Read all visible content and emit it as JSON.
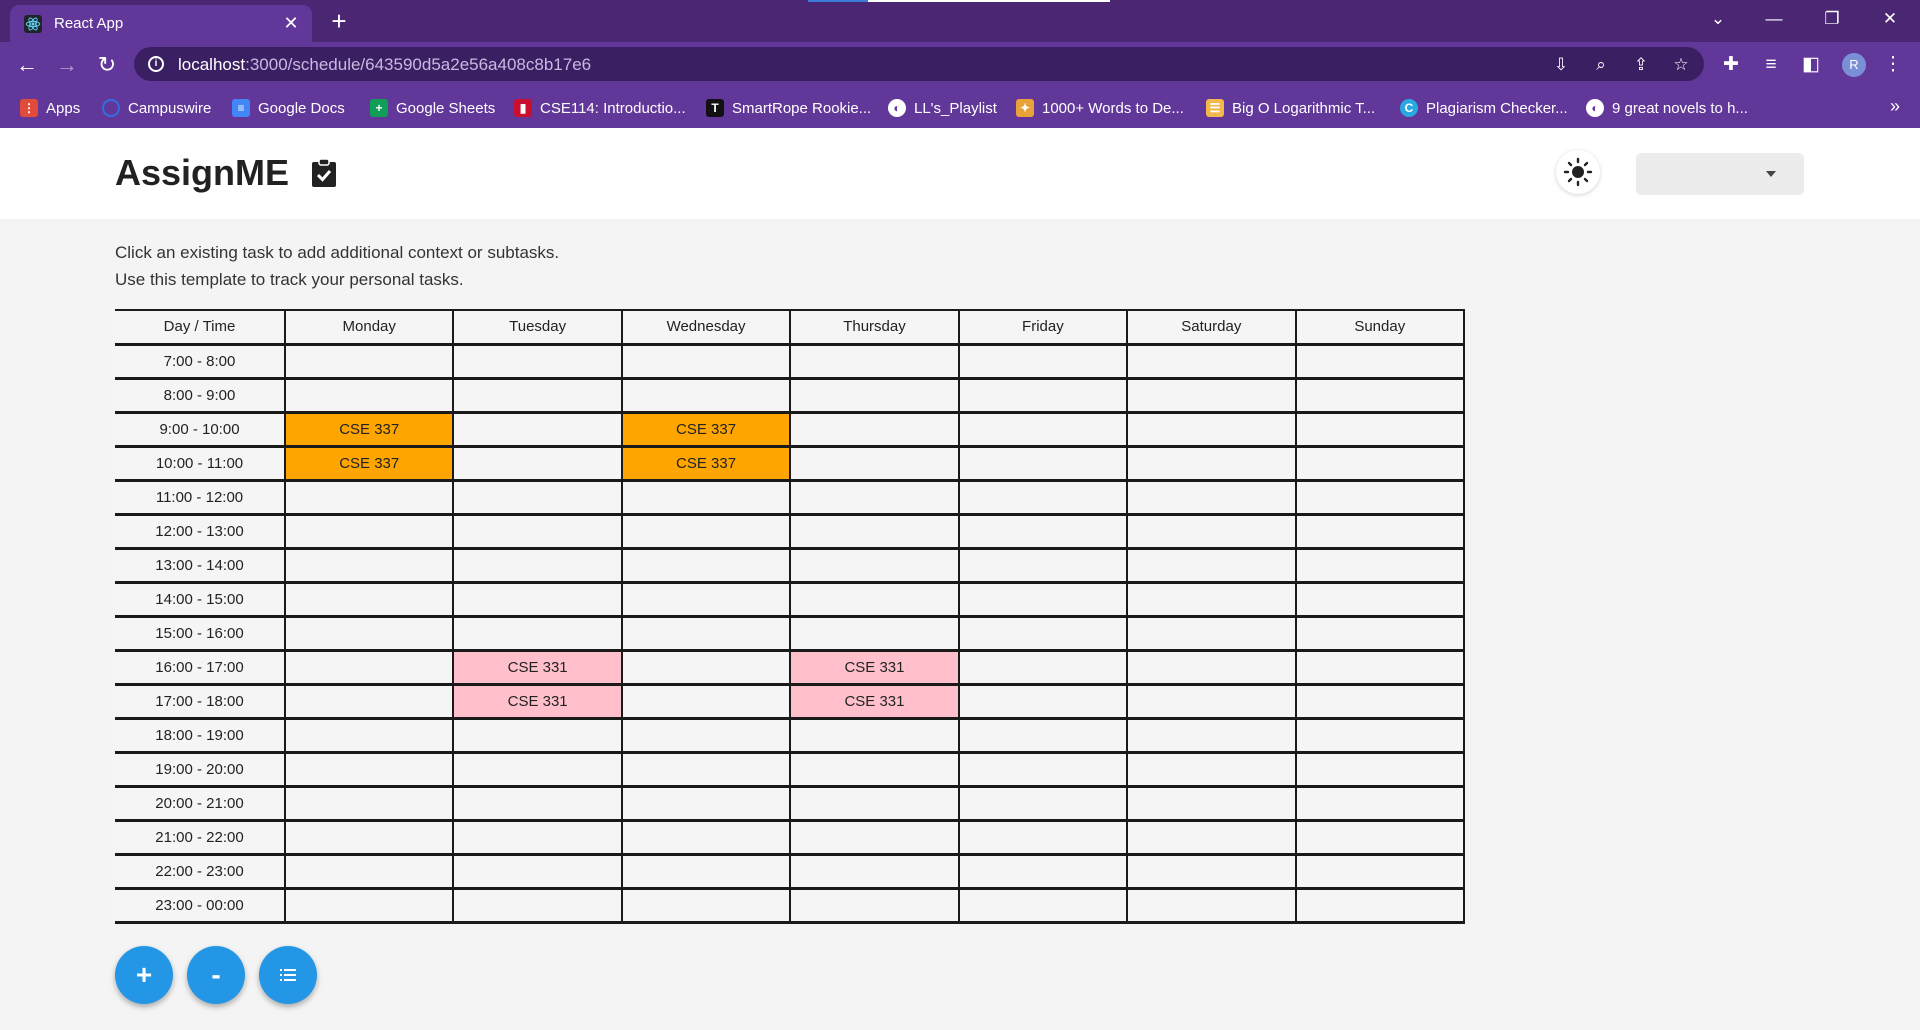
{
  "browser": {
    "tab_title": "React App",
    "url_host": "localhost",
    "url_rest": ":3000/schedule/643590d5a2e56a408c8b17e6",
    "profile_initial": "R",
    "bookmarks": [
      {
        "label": "Apps",
        "icon": "apps-grid-icon",
        "color": "#e04b3a"
      },
      {
        "label": "Campuswire",
        "icon": "campuswire-icon",
        "color": "#2f6fe0"
      },
      {
        "label": "Google Docs",
        "icon": "google-docs-icon",
        "color": "#4285f4"
      },
      {
        "label": "Google Sheets",
        "icon": "google-sheets-icon",
        "color": "#0f9d58"
      },
      {
        "label": "CSE114: Introductio...",
        "icon": "stony-brook-icon",
        "color": "#c8102e"
      },
      {
        "label": "SmartRope Rookie...",
        "icon": "t-logo-icon",
        "color": "#111111"
      },
      {
        "label": "LL's_Playlist",
        "icon": "globe-icon",
        "color": "#ffffff"
      },
      {
        "label": "1000+ Words to De...",
        "icon": "bird-icon",
        "color": "#e8a23a"
      },
      {
        "label": "Big O Logarithmic T...",
        "icon": "stackexchange-icon",
        "color": "#f2b84b"
      },
      {
        "label": "Plagiarism Checker...",
        "icon": "plagiarism-checker-icon",
        "color": "#2aa8e0"
      },
      {
        "label": "9 great novels to h...",
        "icon": "globe-icon",
        "color": "#ffffff"
      }
    ]
  },
  "app": {
    "title": "AssignME",
    "instructions": [
      "Click an existing task to add additional context or subtasks.",
      "Use this template to track your personal tasks."
    ],
    "dropdown_value": "",
    "schedule": {
      "header": [
        "Day / Time",
        "Monday",
        "Tuesday",
        "Wednesday",
        "Thursday",
        "Friday",
        "Saturday",
        "Sunday"
      ],
      "rows": [
        {
          "time": "7:00 - 8:00",
          "cells": [
            "",
            "",
            "",
            "",
            "",
            "",
            ""
          ]
        },
        {
          "time": "8:00 - 9:00",
          "cells": [
            "",
            "",
            "",
            "",
            "",
            "",
            ""
          ]
        },
        {
          "time": "9:00 - 10:00",
          "cells": [
            "CSE 337",
            "",
            "CSE 337",
            "",
            "",
            "",
            ""
          ]
        },
        {
          "time": "10:00 - 11:00",
          "cells": [
            "CSE 337",
            "",
            "CSE 337",
            "",
            "",
            "",
            ""
          ]
        },
        {
          "time": "11:00 - 12:00",
          "cells": [
            "",
            "",
            "",
            "",
            "",
            "",
            ""
          ]
        },
        {
          "time": "12:00 - 13:00",
          "cells": [
            "",
            "",
            "",
            "",
            "",
            "",
            ""
          ]
        },
        {
          "time": "13:00 - 14:00",
          "cells": [
            "",
            "",
            "",
            "",
            "",
            "",
            ""
          ]
        },
        {
          "time": "14:00 - 15:00",
          "cells": [
            "",
            "",
            "",
            "",
            "",
            "",
            ""
          ]
        },
        {
          "time": "15:00 - 16:00",
          "cells": [
            "",
            "",
            "",
            "",
            "",
            "",
            ""
          ]
        },
        {
          "time": "16:00 - 17:00",
          "cells": [
            "",
            "CSE 331",
            "",
            "CSE 331",
            "",
            "",
            ""
          ]
        },
        {
          "time": "17:00 - 18:00",
          "cells": [
            "",
            "CSE 331",
            "",
            "CSE 331",
            "",
            "",
            ""
          ]
        },
        {
          "time": "18:00 - 19:00",
          "cells": [
            "",
            "",
            "",
            "",
            "",
            "",
            ""
          ]
        },
        {
          "time": "19:00 - 20:00",
          "cells": [
            "",
            "",
            "",
            "",
            "",
            "",
            ""
          ]
        },
        {
          "time": "20:00 - 21:00",
          "cells": [
            "",
            "",
            "",
            "",
            "",
            "",
            ""
          ]
        },
        {
          "time": "21:00 - 22:00",
          "cells": [
            "",
            "",
            "",
            "",
            "",
            "",
            ""
          ]
        },
        {
          "time": "22:00 - 23:00",
          "cells": [
            "",
            "",
            "",
            "",
            "",
            "",
            ""
          ]
        },
        {
          "time": "23:00 - 00:00",
          "cells": [
            "",
            "",
            "",
            "",
            "",
            "",
            ""
          ]
        }
      ],
      "task_colors": {
        "CSE 337": "#ffa500",
        "CSE 331": "#ffc0cb"
      }
    },
    "fab": {
      "add_label": "+",
      "remove_label": "-"
    }
  }
}
